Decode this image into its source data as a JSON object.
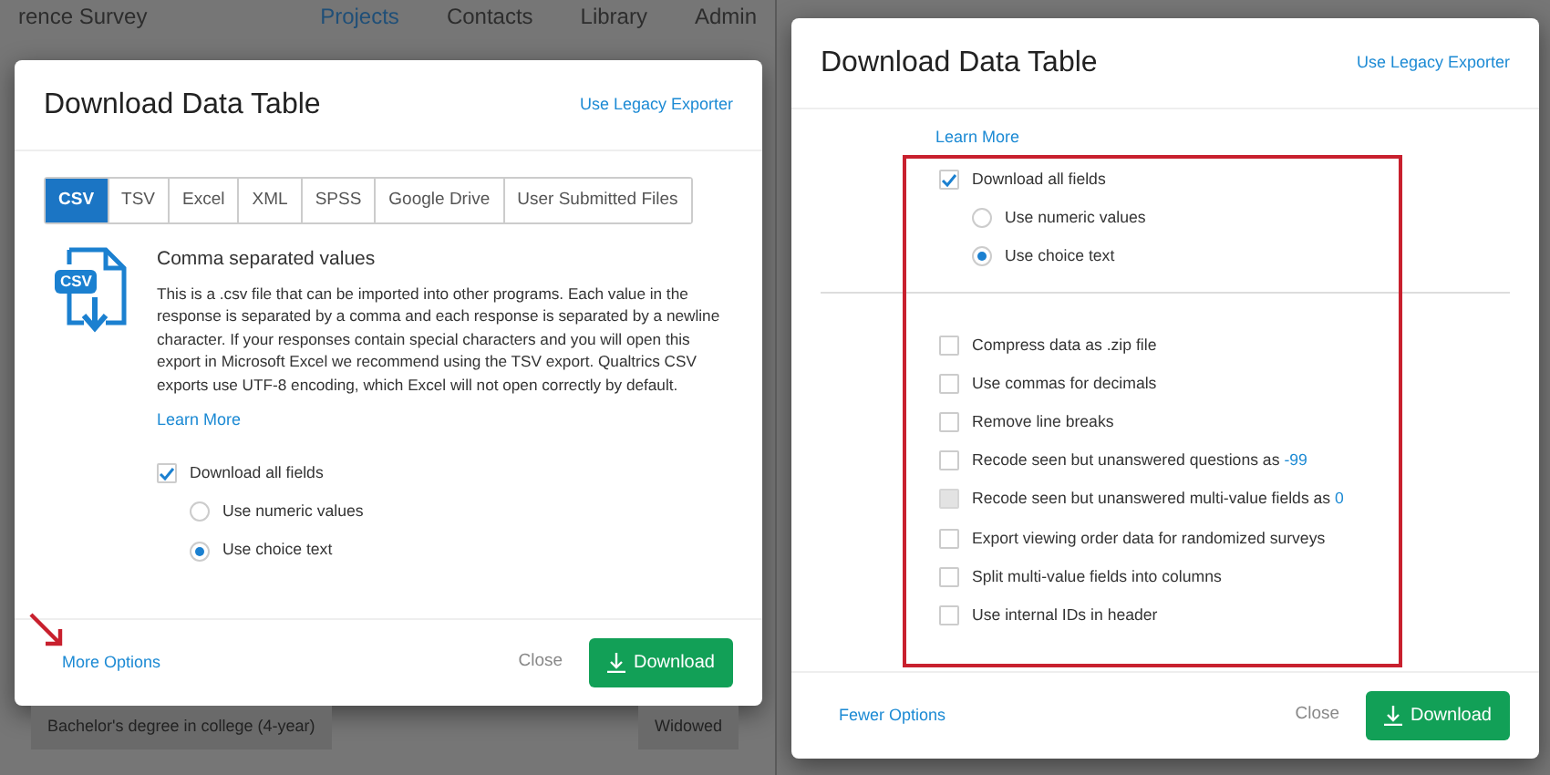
{
  "panels": [
    {
      "annotation": {
        "kind": "arrow"
      },
      "backdrop": {
        "title": "rence Survey",
        "nav": [
          {
            "label": "Projects",
            "selected": true
          },
          {
            "label": "Contacts",
            "selected": false
          },
          {
            "label": "Library",
            "selected": false
          },
          {
            "label": "Admin",
            "selected": false
          }
        ],
        "cells": [
          "Bachelor's degree in college (4-year)",
          "Widowed"
        ]
      },
      "modal": {
        "title": "Download Data Table",
        "legacy_link": "Use Legacy Exporter",
        "tabs": [
          {
            "label": "CSV",
            "selected": true
          },
          {
            "label": "TSV",
            "selected": false
          },
          {
            "label": "Excel",
            "selected": false
          },
          {
            "label": "XML",
            "selected": false
          },
          {
            "label": "SPSS",
            "selected": false
          },
          {
            "label": "Google Drive",
            "selected": false
          },
          {
            "label": "User Submitted Files",
            "selected": false
          }
        ],
        "format": {
          "icon_label": "CSV",
          "heading": "Comma separated values",
          "description": "This is a .csv file that can be imported into other programs. Each value in the response is separated by a comma and each response is separated by a newline character. If your responses contain special characters and you will open this export in Microsoft Excel we recommend using the TSV export. Qualtrics CSV exports use UTF-8 encoding, which Excel will not open correctly by default."
        },
        "learn_more": "Learn More",
        "download_all": {
          "label": "Download all fields",
          "checked": true
        },
        "value_modes": [
          {
            "label": "Use numeric values",
            "selected": false
          },
          {
            "label": "Use choice text",
            "selected": true
          }
        ],
        "footer": {
          "options_link": "More Options",
          "close": "Close",
          "download": "Download"
        }
      }
    },
    {
      "annotation": {
        "kind": "box"
      },
      "modal": {
        "title": "Download Data Table",
        "legacy_link": "Use Legacy Exporter",
        "learn_more": "Learn More",
        "download_all": {
          "label": "Download all fields",
          "checked": true
        },
        "value_modes": [
          {
            "label": "Use numeric values",
            "selected": false
          },
          {
            "label": "Use choice text",
            "selected": true
          }
        ],
        "options": [
          {
            "label": "Compress data as .zip file",
            "checked": false,
            "disabled": false
          },
          {
            "label": "Use commas for decimals",
            "checked": false,
            "disabled": false
          },
          {
            "label": "Remove line breaks",
            "checked": false,
            "disabled": false
          },
          {
            "label": "Recode seen but unanswered questions as",
            "value": "-99",
            "checked": false,
            "disabled": false
          },
          {
            "label": "Recode seen but unanswered multi-value fields as",
            "value": "0",
            "checked": false,
            "disabled": true
          },
          {
            "label": "Export viewing order data for randomized surveys",
            "checked": false,
            "disabled": false
          },
          {
            "label": "Split multi-value fields into columns",
            "checked": false,
            "disabled": false
          },
          {
            "label": "Use internal IDs in header",
            "checked": false,
            "disabled": false
          }
        ],
        "footer": {
          "options_link": "Fewer Options",
          "close": "Close",
          "download": "Download"
        }
      }
    }
  ]
}
